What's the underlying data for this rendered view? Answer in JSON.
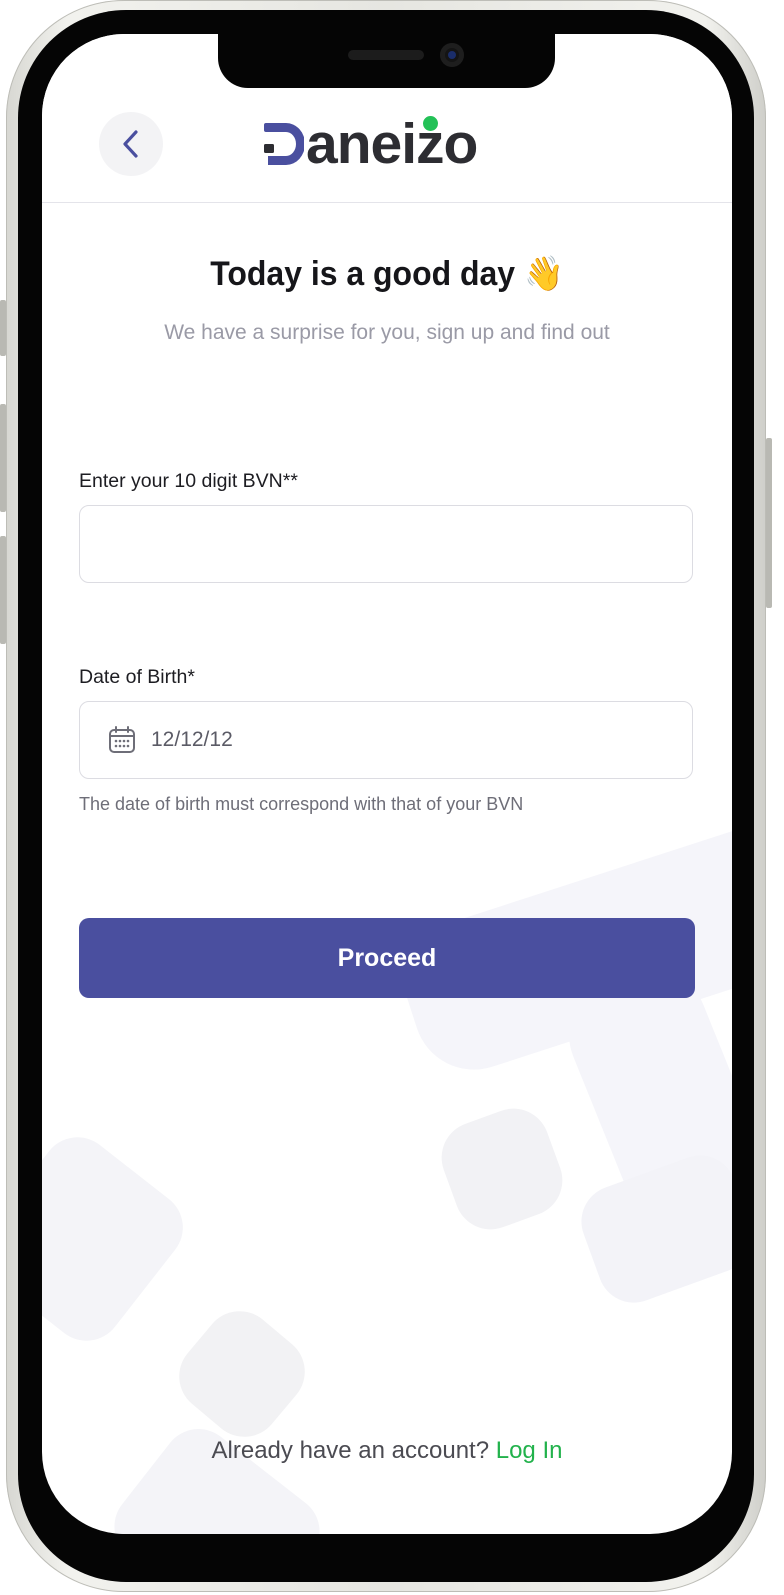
{
  "header": {
    "back_icon": "chevron-left-icon",
    "logo_text": "aneizo",
    "colors": {
      "brand_dark": "#2d2d32",
      "brand_accent": "#4a4f9f",
      "logo_dot": "#23c157"
    }
  },
  "hero": {
    "title": "Today is a good day",
    "emoji": "👋",
    "subtitle": "We have a surprise for you, sign up and find out"
  },
  "form": {
    "bvn": {
      "label": "Enter your 10 digit BVN**",
      "value": ""
    },
    "dob": {
      "label": "Date of Birth*",
      "value": "12/12/12",
      "icon": "calendar-icon",
      "hint": "The date of birth must correspond with that of your BVN"
    },
    "proceed_label": "Proceed"
  },
  "footer": {
    "prompt": "Already have an account?",
    "login_label": "Log In",
    "login_color": "#22b24c"
  }
}
